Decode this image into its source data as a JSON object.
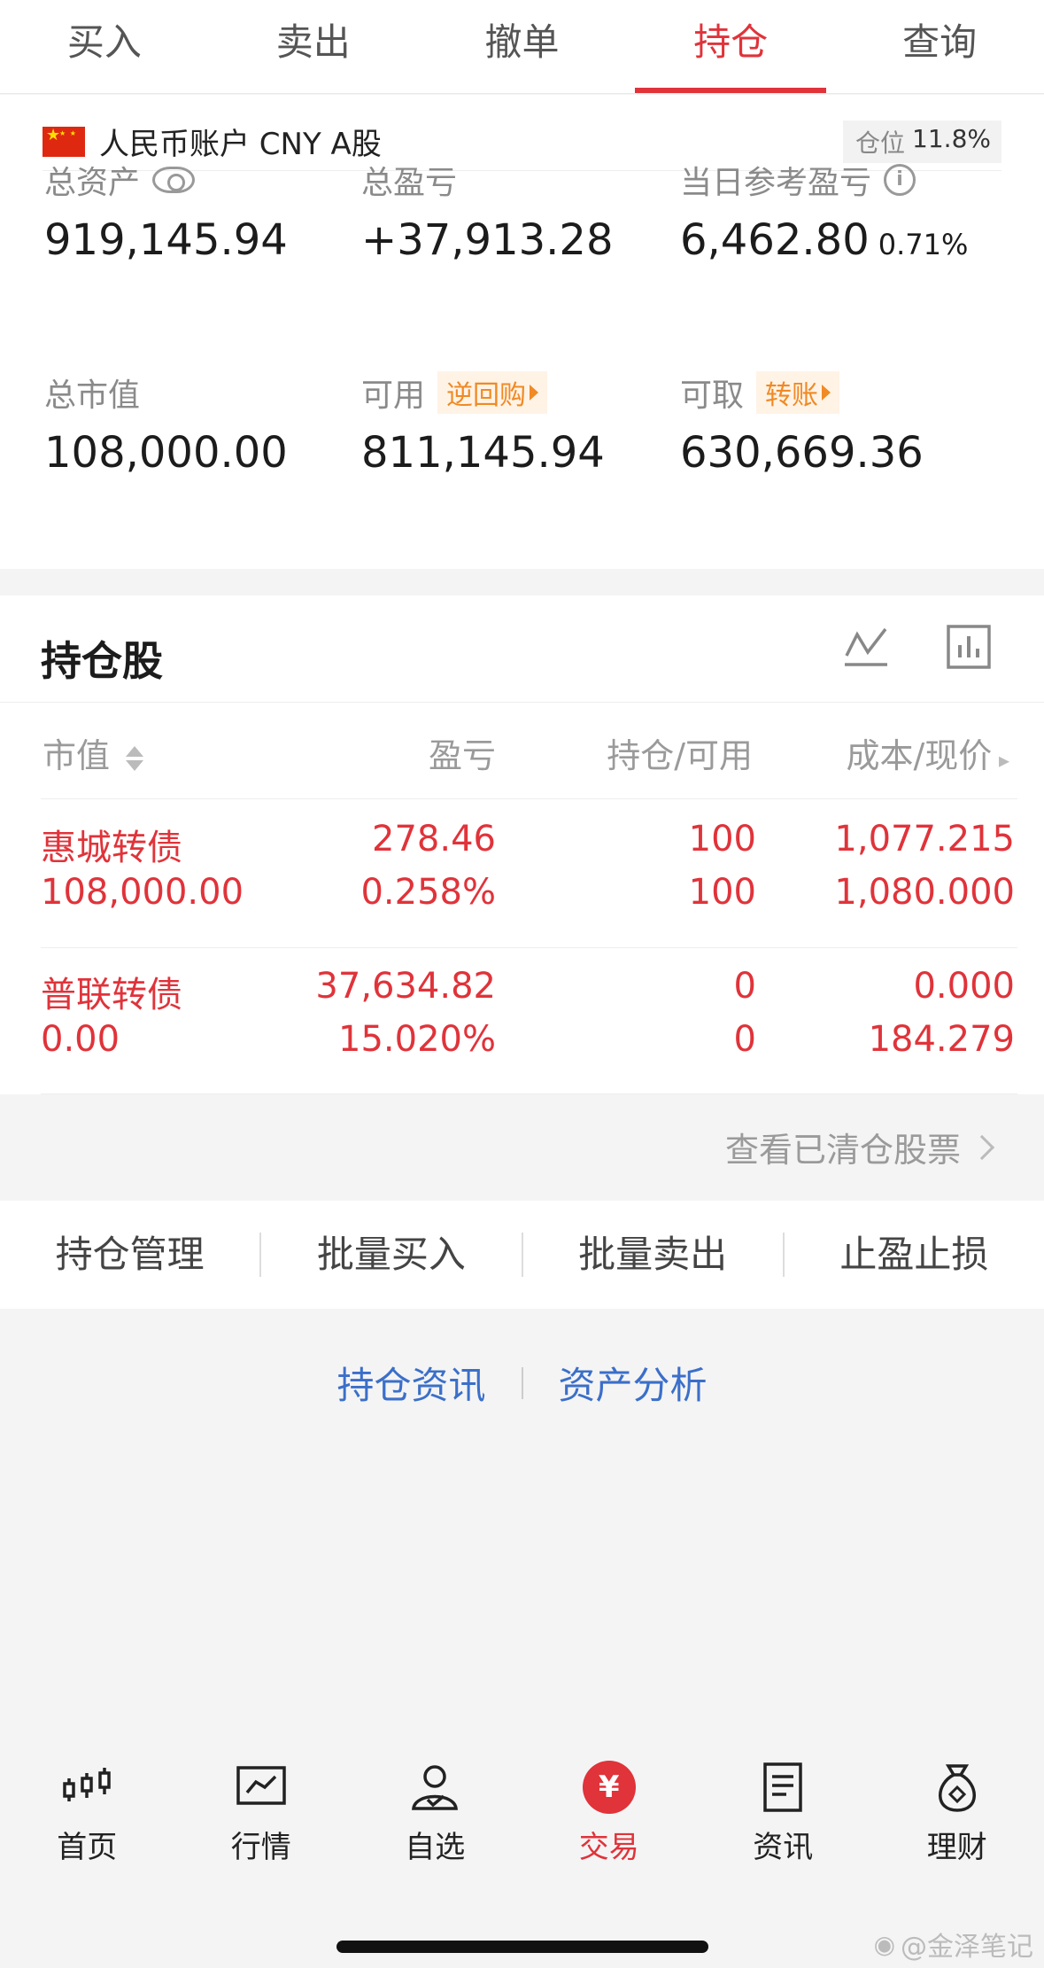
{
  "tabs": [
    {
      "label": "买入",
      "active": false
    },
    {
      "label": "卖出",
      "active": false
    },
    {
      "label": "撤单",
      "active": false
    },
    {
      "label": "持仓",
      "active": true
    },
    {
      "label": "查询",
      "active": false
    }
  ],
  "account": {
    "name": "人民币账户 CNY A股",
    "position_label": "仓位",
    "position_value": "11.8%"
  },
  "metrics": {
    "total_assets_label": "总资产",
    "total_assets": "919,145.94",
    "total_pnl_label": "总盈亏",
    "total_pnl": "+37,913.28",
    "daily_pnl_label": "当日参考盈亏",
    "daily_pnl": "6,462.80",
    "daily_pnl_pct": "0.71%",
    "market_value_label": "总市值",
    "market_value": "108,000.00",
    "available_label": "可用",
    "available_tag": "逆回购",
    "available": "811,145.94",
    "withdrawable_label": "可取",
    "withdrawable_tag": "转账",
    "withdrawable": "630,669.36"
  },
  "holdings": {
    "title": "持仓股",
    "columns": [
      "市值",
      "盈亏",
      "持仓/可用",
      "成本/现价"
    ],
    "rows": [
      {
        "name": "惠城转债",
        "market_value": "108,000.00",
        "pnl": "278.46",
        "pnl_pct": "0.258%",
        "position": "100",
        "available": "100",
        "cost": "1,077.215",
        "price": "1,080.000"
      },
      {
        "name": "普联转债",
        "market_value": "0.00",
        "pnl": "37,634.82",
        "pnl_pct": "15.020%",
        "position": "0",
        "available": "0",
        "cost": "0.000",
        "price": "184.279"
      }
    ],
    "cleared_link": "查看已清仓股票"
  },
  "actions": [
    "持仓管理",
    "批量买入",
    "批量卖出",
    "止盈止损"
  ],
  "links": [
    "持仓资讯",
    "资产分析"
  ],
  "nav": [
    {
      "label": "首页",
      "icon": "candlestick-icon",
      "active": false
    },
    {
      "label": "行情",
      "icon": "chart-icon",
      "active": false
    },
    {
      "label": "自选",
      "icon": "user-check-icon",
      "active": false
    },
    {
      "label": "交易",
      "icon": "yen-icon",
      "active": true
    },
    {
      "label": "资讯",
      "icon": "document-icon",
      "active": false
    },
    {
      "label": "理财",
      "icon": "money-bag-icon",
      "active": false
    }
  ],
  "watermark": "@金泽笔记",
  "colors": {
    "accent": "#e0333a",
    "link": "#3b6fc9",
    "tag": "#f08a24"
  }
}
